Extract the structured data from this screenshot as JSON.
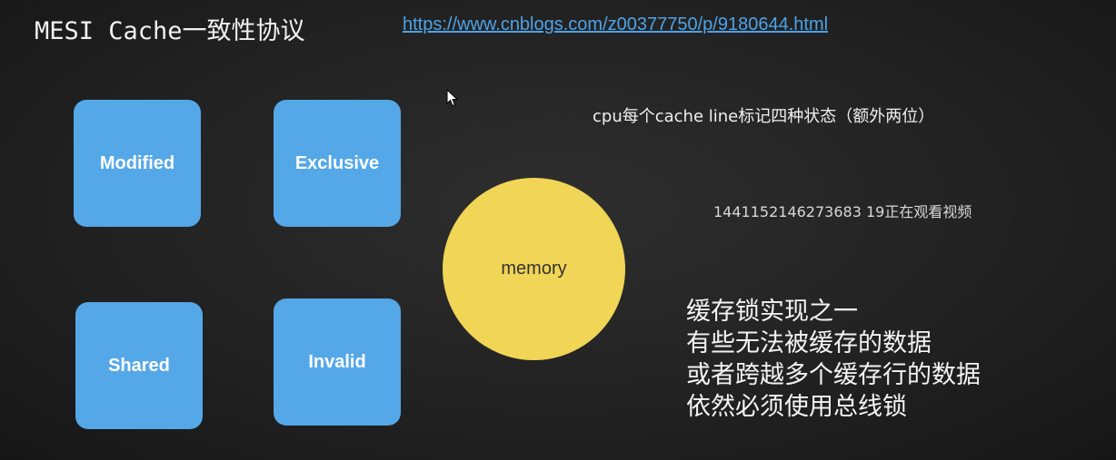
{
  "slide": {
    "title": "MESI Cache一致性协议",
    "link": "https://www.cnblogs.com/z00377750/p/9180644.html",
    "states": {
      "modified": "Modified",
      "exclusive": "Exclusive",
      "shared": "Shared",
      "invalid": "Invalid"
    },
    "memory_label": "memory",
    "note": "cpu每个cache line标记四种状态（额外两位）",
    "watermark": "1441152146273683 19正在观看视频",
    "lock_notes": [
      "缓存锁实现之一",
      "有些无法被缓存的数据",
      "或者跨越多个缓存行的数据",
      "依然必须使用总线锁"
    ]
  },
  "colors": {
    "background": "#222222",
    "state_box": "#55a8e8",
    "memory_circle": "#f0d556",
    "link": "#4da3e8"
  },
  "icons": {
    "cursor": "mouse-pointer-icon"
  }
}
